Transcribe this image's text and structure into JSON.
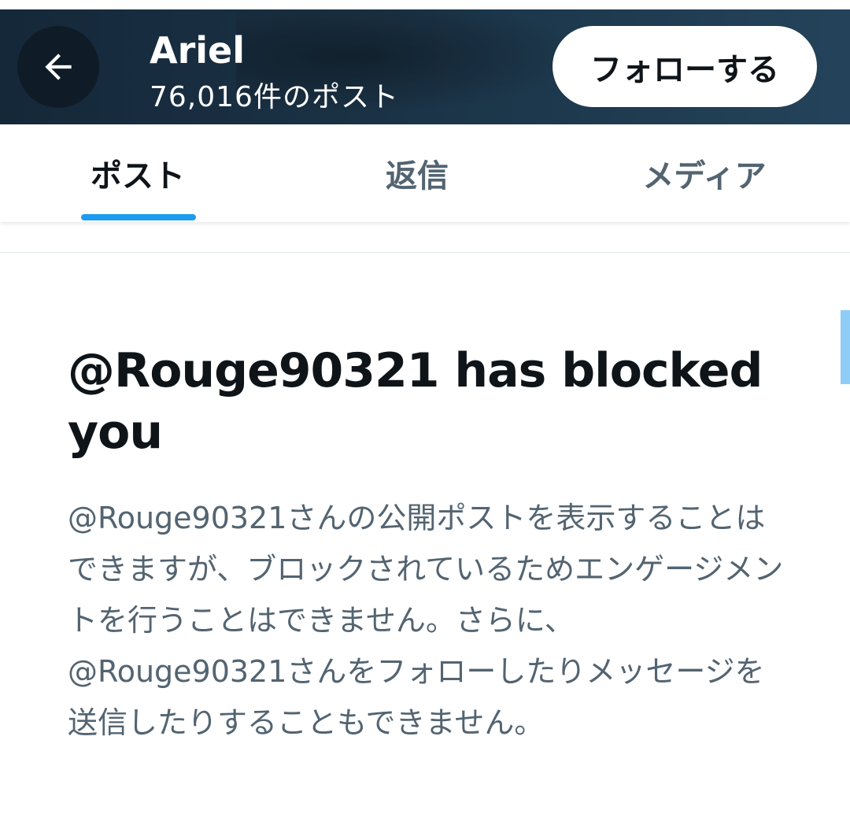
{
  "header": {
    "title": "Ariel",
    "post_count": "76,016件のポスト",
    "back_icon": "arrow-left-icon",
    "follow_label": "フォローする"
  },
  "tabs": [
    {
      "label": "ポスト",
      "active": true
    },
    {
      "label": "返信",
      "active": false
    },
    {
      "label": "メディア",
      "active": false
    }
  ],
  "blocked": {
    "heading": "@Rouge90321 has blocked you",
    "body": "@Rouge90321さんの公開ポストを表示することはできますが、ブロックされているためエンゲージメントを行うことはできません。さらに、@Rouge90321さんをフォローしたりメッセージを送信したりすることもできません。"
  },
  "colors": {
    "accent": "#1d9bf0",
    "header_bg": "#1a3144",
    "text_primary": "#0f1419",
    "text_secondary": "#536471"
  }
}
